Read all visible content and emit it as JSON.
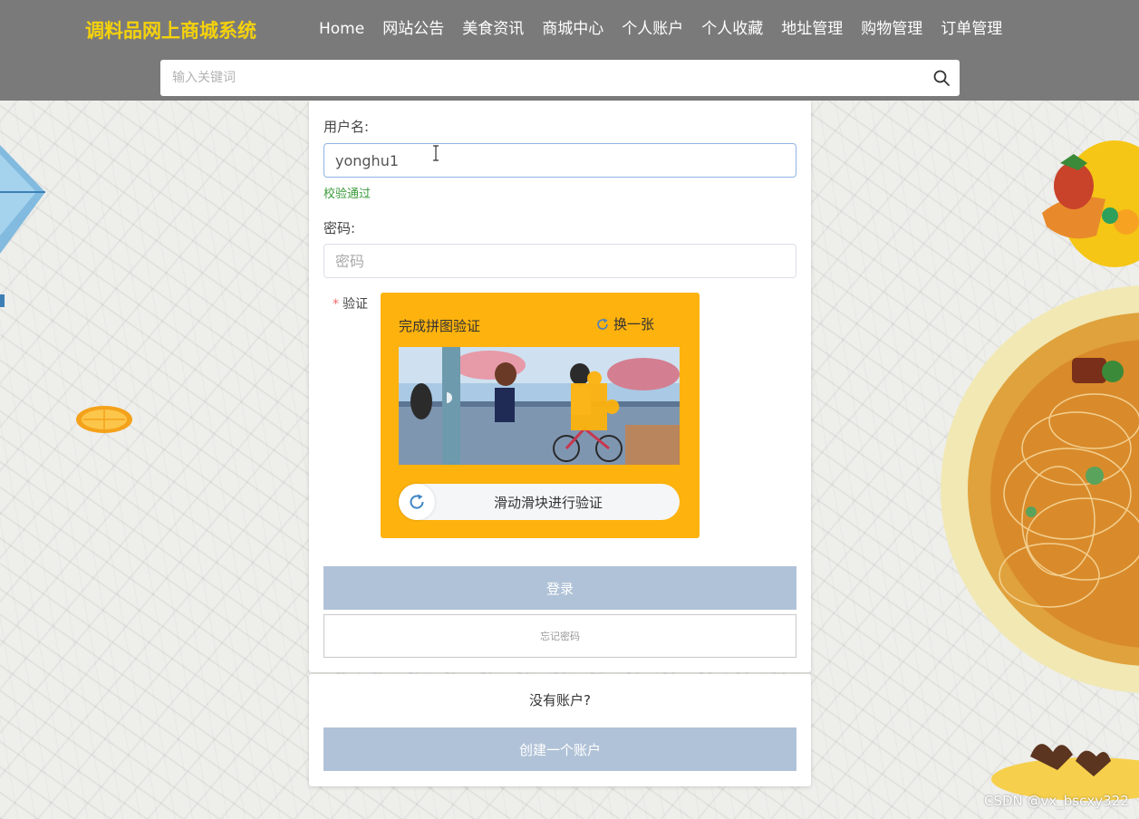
{
  "header": {
    "brand": "调料品网上商城系统",
    "nav": [
      "Home",
      "网站公告",
      "美食资讯",
      "商城中心",
      "个人账户",
      "个人收藏",
      "地址管理",
      "购物管理",
      "订单管理"
    ],
    "search_placeholder": "输入关键词",
    "search_icon": "search-icon"
  },
  "login": {
    "username_label": "用户名:",
    "username_value": "yonghu1",
    "username_status": "校验通过",
    "password_label": "密码:",
    "password_placeholder": "密码",
    "captcha_required_mark": "*",
    "captcha_label": "验证",
    "captcha_title": "完成拼图验证",
    "captcha_refresh": "换一张",
    "slider_text": "滑动滑块进行验证",
    "login_button": "登录",
    "forgot_button": "忘记密码"
  },
  "register": {
    "prompt": "没有账户?",
    "create_button": "创建一个账户"
  },
  "watermark": "CSDN @vx_bscxy322",
  "colors": {
    "header_bg": "#7b7a7b",
    "brand": "#f5d20b",
    "captcha_bg": "#fdb20d",
    "button_bg": "#b0c2d7",
    "valid_text": "#3a9a3a"
  }
}
